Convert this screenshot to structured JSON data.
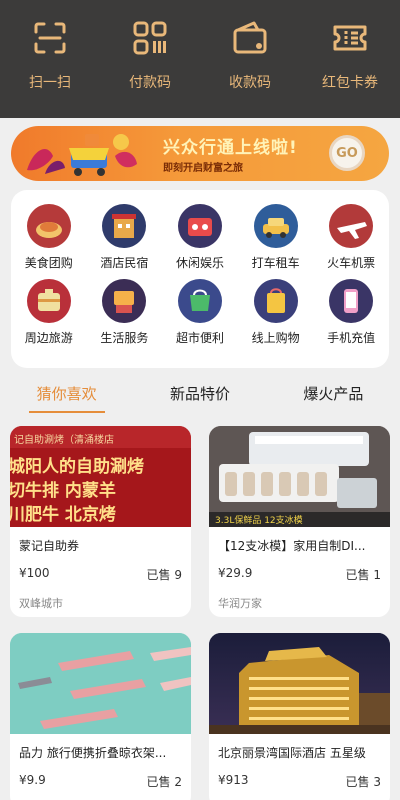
{
  "header": {
    "items": [
      {
        "label": "扫一扫",
        "icon": "scan-icon"
      },
      {
        "label": "付款码",
        "icon": "qr-pay-icon"
      },
      {
        "label": "收款码",
        "icon": "wallet-receive-icon"
      },
      {
        "label": "红包卡券",
        "icon": "coupon-icon"
      }
    ]
  },
  "banner": {
    "title": "兴众行通上线啦!",
    "subtitle": "即刻开启财富之旅",
    "tag": "GO"
  },
  "categories": [
    {
      "label": "美食团购",
      "icon": "food-icon",
      "color": "#b53a3a"
    },
    {
      "label": "酒店民宿",
      "icon": "hotel-icon",
      "color": "#2f3b6b"
    },
    {
      "label": "休闲娱乐",
      "icon": "leisure-icon",
      "color": "#3a3566"
    },
    {
      "label": "打车租车",
      "icon": "car-icon",
      "color": "#2f5d9a"
    },
    {
      "label": "火车机票",
      "icon": "plane-icon",
      "color": "#b23a3a"
    },
    {
      "label": "周边旅游",
      "icon": "travel-icon",
      "color": "#b9303a"
    },
    {
      "label": "生活服务",
      "icon": "service-icon",
      "color": "#3b2d55"
    },
    {
      "label": "超市便利",
      "icon": "market-icon",
      "color": "#3b4a8c"
    },
    {
      "label": "线上购物",
      "icon": "shopping-icon",
      "color": "#3a3f7a"
    },
    {
      "label": "手机充值",
      "icon": "phone-recharge-icon",
      "color": "#3a3566"
    }
  ],
  "tabs": [
    {
      "label": "猜你喜欢",
      "active": true
    },
    {
      "label": "新品特价",
      "active": false
    },
    {
      "label": "爆火产品",
      "active": false
    }
  ],
  "products": [
    {
      "title": "蒙记自助券",
      "price": "¥100",
      "sold": "已售 9",
      "shop": "双峰城市",
      "image_text": [
        "记自助涮烤（清涌楼店",
        "城阳人的自助涮烤",
        "切牛排 内蒙羊",
        "川肥牛 北京烤"
      ]
    },
    {
      "title": "【12支冰模】家用自制DI...",
      "price": "¥29.9",
      "sold": "已售 1",
      "shop": "华润万家",
      "image_text": [
        "3.3L保鲜品 12支冰模"
      ]
    },
    {
      "title": "品力 旅行便携折叠晾衣架...",
      "price": "¥9.9",
      "sold": "已售 2",
      "shop": ""
    },
    {
      "title": "北京丽景湾国际酒店 五星级",
      "price": "¥913",
      "sold": "已售 3",
      "shop": ""
    }
  ]
}
